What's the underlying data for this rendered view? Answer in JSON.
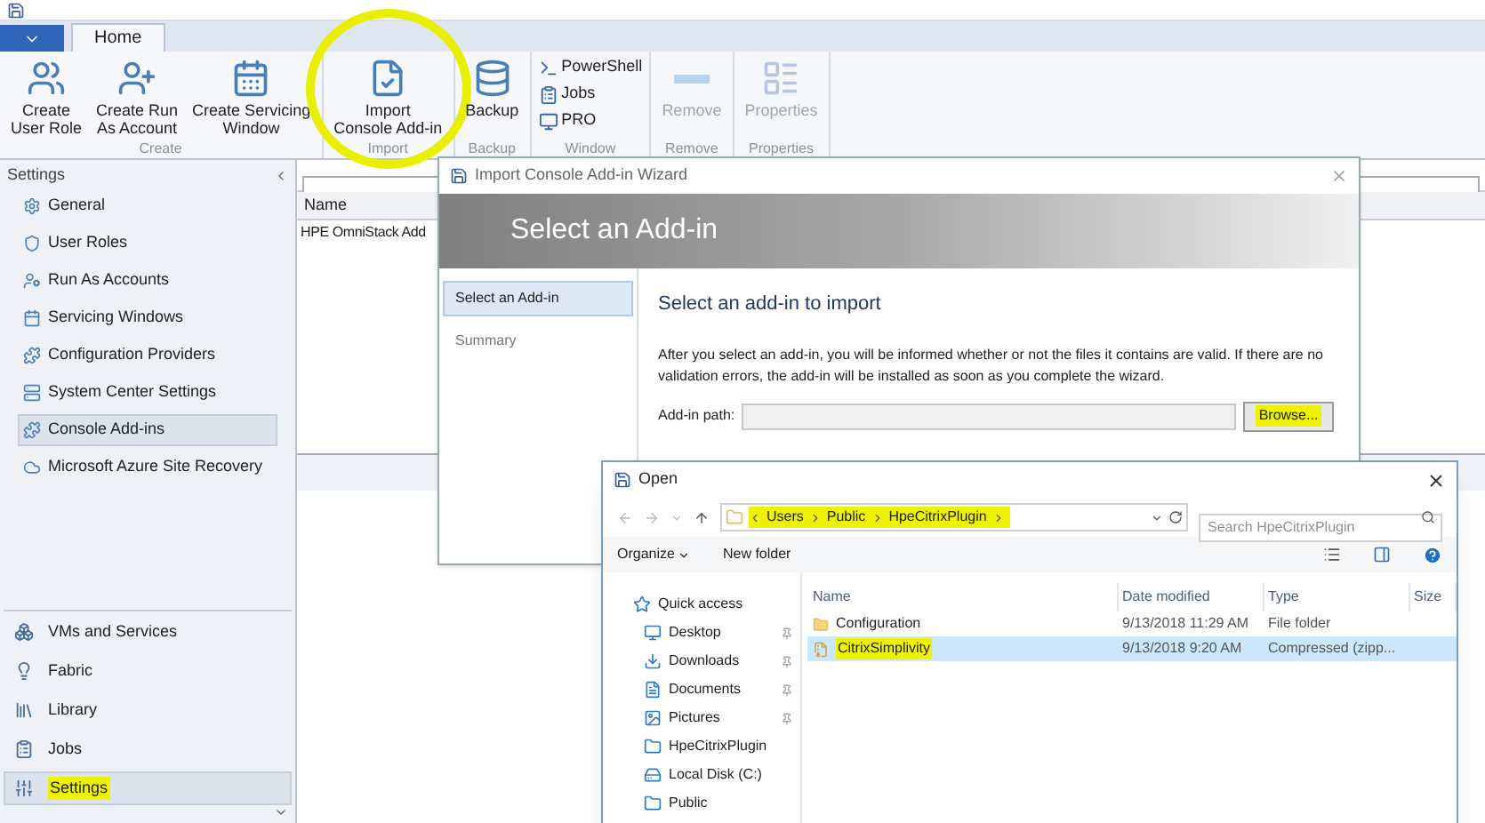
{
  "ribbon": {
    "tabs": [
      {
        "label": "Home",
        "selected": true
      }
    ],
    "groups": [
      {
        "label": "Create",
        "annotated": false,
        "buttons": [
          {
            "label": "Create\nUser Role",
            "kind": "user-role",
            "disabled": false
          },
          {
            "label": "Create Run\nAs Account",
            "kind": "run-as",
            "disabled": false
          },
          {
            "label": "Create Servicing\nWindow",
            "kind": "calendar",
            "disabled": false
          }
        ]
      },
      {
        "label": "Import",
        "annotated": true,
        "buttons": [
          {
            "label": "Import\nConsole Add-in",
            "kind": "import",
            "disabled": false
          }
        ]
      },
      {
        "label": "Backup",
        "annotated": false,
        "buttons": [
          {
            "label": "Backup",
            "kind": "backup",
            "disabled": false
          }
        ]
      },
      {
        "label": "Window",
        "annotated": false,
        "small": [
          {
            "label": "PowerShell",
            "kind": "powershell"
          },
          {
            "label": "Jobs",
            "kind": "jobs"
          },
          {
            "label": "PRO",
            "kind": "pro"
          }
        ]
      },
      {
        "label": "Remove",
        "annotated": false,
        "buttons": [
          {
            "label": "Remove",
            "kind": "remove",
            "disabled": true
          }
        ]
      },
      {
        "label": "Properties",
        "annotated": false,
        "buttons": [
          {
            "label": "Properties",
            "kind": "properties",
            "disabled": true
          }
        ]
      }
    ]
  },
  "sidebar": {
    "title": "Settings",
    "items": [
      {
        "label": "General",
        "selected": false
      },
      {
        "label": "User Roles",
        "selected": false
      },
      {
        "label": "Run As Accounts",
        "selected": false
      },
      {
        "label": "Servicing Windows",
        "selected": false
      },
      {
        "label": "Configuration Providers",
        "selected": false
      },
      {
        "label": "System Center Settings",
        "selected": false
      },
      {
        "label": "Console Add-ins",
        "selected": true
      },
      {
        "label": "Microsoft Azure Site Recovery",
        "selected": false
      }
    ],
    "workspaces": [
      {
        "label": "VMs and Services",
        "selected": false,
        "highlighted": false
      },
      {
        "label": "Fabric",
        "selected": false,
        "highlighted": false
      },
      {
        "label": "Library",
        "selected": false,
        "highlighted": false
      },
      {
        "label": "Jobs",
        "selected": false,
        "highlighted": false
      },
      {
        "label": "Settings",
        "selected": true,
        "highlighted": true
      }
    ]
  },
  "list": {
    "columns": [
      "Name"
    ],
    "rows": [
      "HPE OmniStack Add"
    ]
  },
  "wizard": {
    "title": "Import Console Add-in Wizard",
    "header": "Select an Add-in",
    "steps": [
      {
        "label": "Select an Add-in",
        "selected": true
      },
      {
        "label": "Summary",
        "selected": false
      }
    ],
    "heading": "Select an add-in to import",
    "description": "After you select an add-in, you will be informed whether or not the files it contains are valid. If there are no validation errors, the add-in will be installed as soon as you complete the wizard.",
    "path_label": "Add-in path:",
    "browse": {
      "label": "Browse...",
      "highlighted": true
    }
  },
  "open_dialog": {
    "title": "Open",
    "breadcrumb": {
      "items": [
        "Users",
        "Public",
        "HpeCitrixPlugin"
      ],
      "highlighted": true
    },
    "search": {
      "placeholder": "Search HpeCitrixPlugin"
    },
    "toolbar": [
      "Organize",
      "New folder"
    ],
    "nav": [
      {
        "label": "Quick access",
        "kind": "star",
        "pinned": false
      },
      {
        "label": "Desktop",
        "kind": "desktop",
        "pinned": true
      },
      {
        "label": "Downloads",
        "kind": "download",
        "pinned": true
      },
      {
        "label": "Documents",
        "kind": "document",
        "pinned": true
      },
      {
        "label": "Pictures",
        "kind": "picture",
        "pinned": true
      },
      {
        "label": "HpeCitrixPlugin",
        "kind": "folder",
        "pinned": false
      },
      {
        "label": "Local Disk (C:)",
        "kind": "disk",
        "pinned": false
      },
      {
        "label": "Public",
        "kind": "folder",
        "pinned": false
      }
    ],
    "columns": [
      "Name",
      "Date modified",
      "Type",
      "Size"
    ],
    "files": [
      {
        "name": "Configuration",
        "date": "9/13/2018 11:29 AM",
        "type": "File folder",
        "kind": "folder",
        "selected": false,
        "highlighted": false
      },
      {
        "name": "CitrixSimplivity",
        "date": "9/13/2018 9:20 AM",
        "type": "Compressed (zipp...",
        "kind": "zip",
        "selected": true,
        "highlighted": true
      }
    ]
  }
}
